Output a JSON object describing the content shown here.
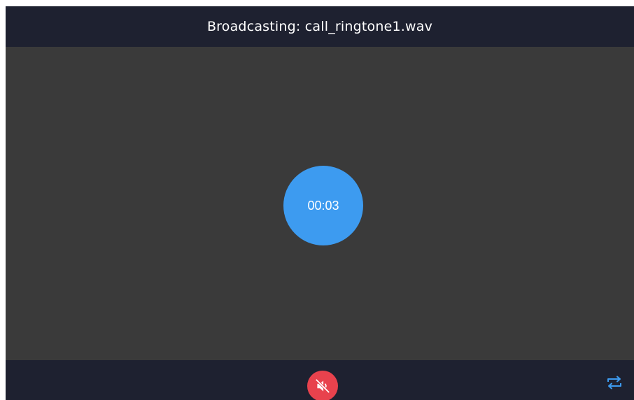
{
  "header": {
    "title": "Broadcasting: call_ringtone1.wav"
  },
  "timer": {
    "elapsed": "00:03",
    "color": "#3d9bf0"
  },
  "footer": {
    "mute_icon": "speaker-muted-icon",
    "mute_color": "#e8424d",
    "repeat_icon": "repeat-icon",
    "repeat_color": "#3d9bf0"
  },
  "theme": {
    "bar_background": "#1e2130",
    "content_background": "#3a3a3a"
  }
}
